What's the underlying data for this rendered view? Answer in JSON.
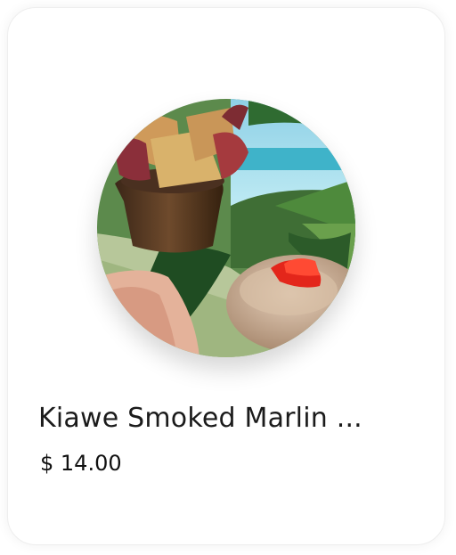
{
  "item": {
    "name": "Kiawe Smoked Marlin ...",
    "price": "$ 14.00",
    "image_icon": "food-photo"
  }
}
